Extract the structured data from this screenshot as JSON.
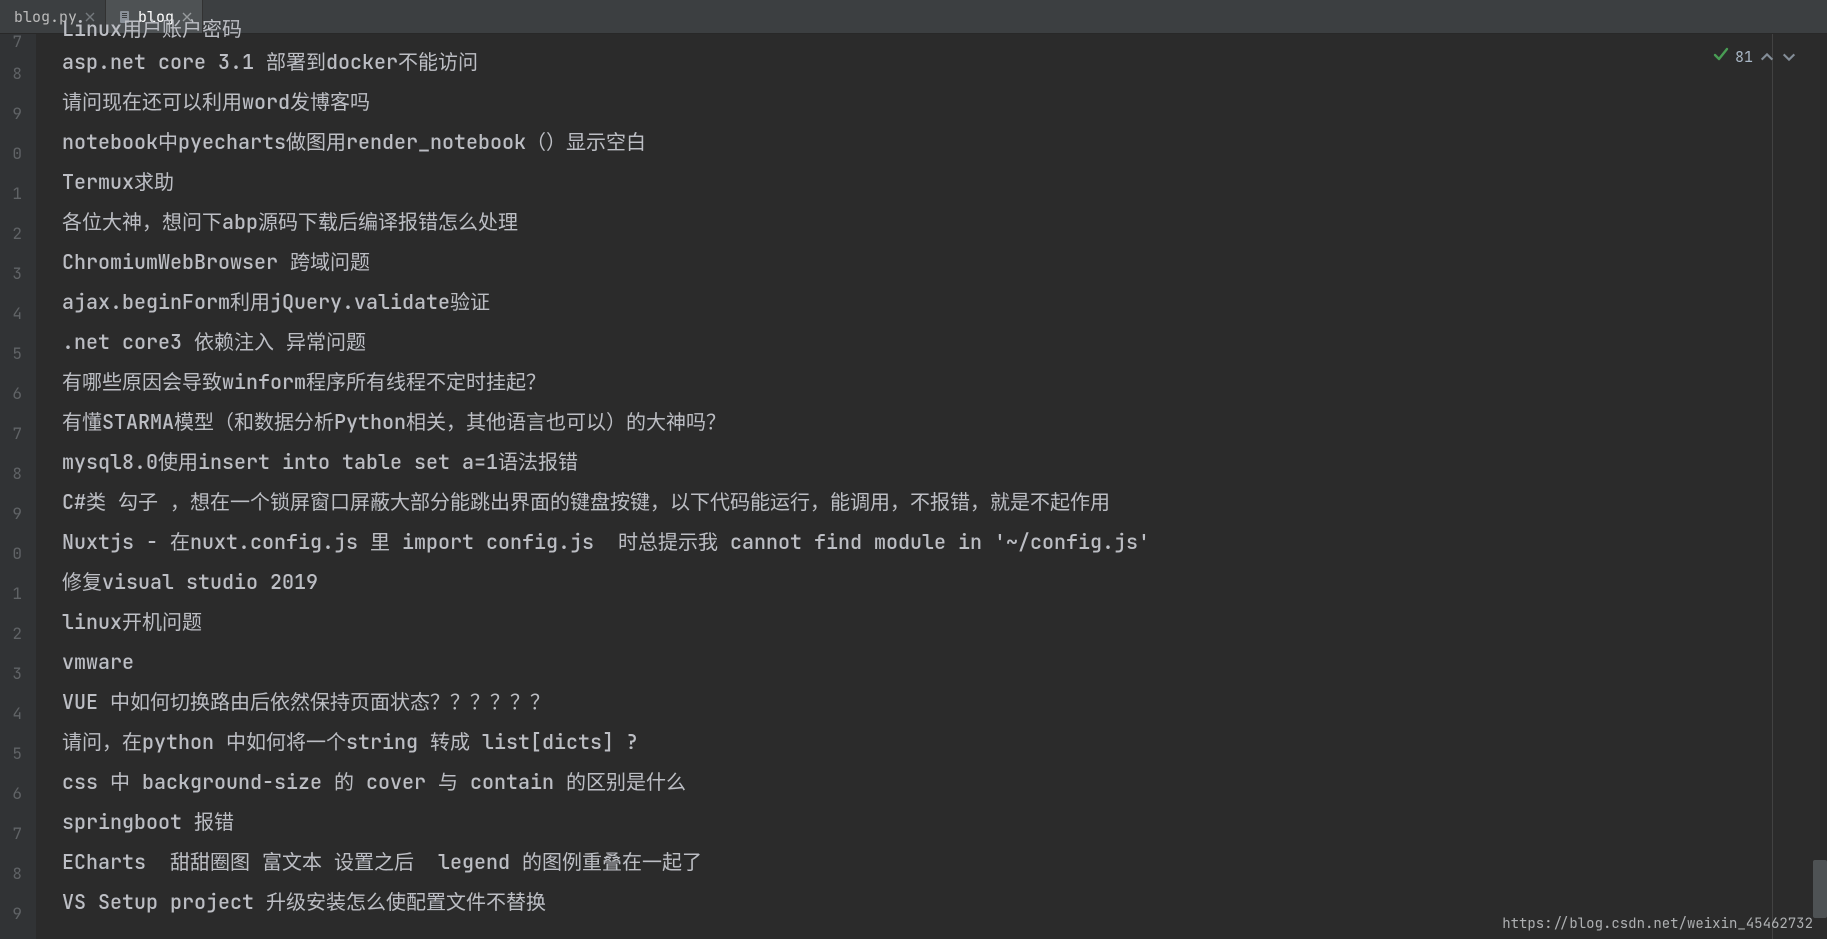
{
  "tabs": [
    {
      "label": "blog.py",
      "active": false,
      "icon": ""
    },
    {
      "label": "blog",
      "active": true,
      "icon": "file"
    }
  ],
  "indicator": {
    "count": "81"
  },
  "gutter_start_digits": [
    "7",
    "8",
    "9",
    "0",
    "1",
    "2",
    "3",
    "4",
    "5",
    "6",
    "7",
    "8",
    "9",
    "0",
    "1",
    "2",
    "3",
    "4",
    "5",
    "6",
    "7",
    "8",
    "9"
  ],
  "lines": [
    "Linux用户账户密码",
    "asp.net core 3.1 部署到docker不能访问",
    "请问现在还可以利用word发博客吗",
    "notebook中pyecharts做图用render_notebook（）显示空白",
    "Termux求助",
    "各位大神，想问下abp源码下载后编译报错怎么处理",
    "ChromiumWebBrowser 跨域问题",
    "ajax.beginForm利用jQuery.validate验证",
    ".net core3 依赖注入 异常问题",
    "有哪些原因会导致winform程序所有线程不定时挂起？",
    "有懂STARMA模型（和数据分析Python相关，其他语言也可以）的大神吗？",
    "mysql8.0使用insert into table set a=1语法报错",
    "C#类 勾子 ，想在一个锁屏窗口屏蔽大部分能跳出界面的键盘按键，以下代码能运行，能调用，不报错，就是不起作用",
    "Nuxtjs - 在nuxt.config.js 里 import config.js  时总提示我 cannot find module in '~/config.js'",
    "修复visual studio 2019",
    "linux开机问题",
    "vmware",
    "VUE 中如何切换路由后依然保持页面状态？？？？？？",
    "请问，在python 中如何将一个string 转成 list[dicts] ?",
    "css 中 background-size 的 cover 与 contain 的区别是什么",
    "springboot 报错",
    "ECharts  甜甜圈图 富文本 设置之后  legend 的图例重叠在一起了",
    "VS Setup project 升级安装怎么使配置文件不替换"
  ],
  "status_url": "https://blog.csdn.net/weixin_45462732"
}
